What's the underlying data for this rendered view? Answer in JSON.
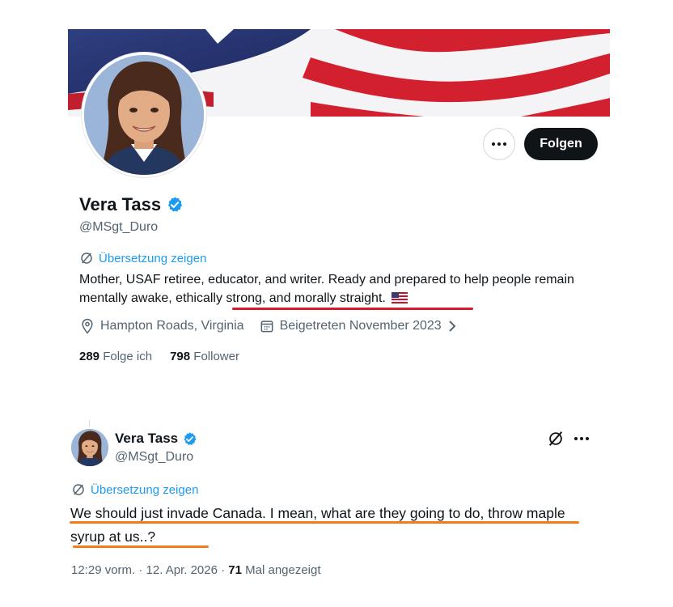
{
  "profile": {
    "name": "Vera Tass",
    "handle": "@MSgt_Duro",
    "translate_label": "Übersetzung zeigen",
    "bio_part1": "Mother, USAF retiree, educator, and writer.  Ready and prepared to help people remain mentally awake, ",
    "bio_part2": "ethically strong, and morally straight.",
    "location": "Hampton Roads, Virginia",
    "joined": "Beigetreten November 2023",
    "following_count": "289",
    "following_label": "Folge ich",
    "followers_count": "798",
    "followers_label": "Follower",
    "follow_button": "Folgen"
  },
  "tweet": {
    "name": "Vera Tass",
    "handle": "@MSgt_Duro",
    "translate_label": "Übersetzung zeigen",
    "text": "We should just invade Canada. I mean, what are they going to do, throw maple syrup at us..?",
    "time": "12:29 vorm. · 12. Apr. 2026 · ",
    "views_count": "71",
    "views_label": " Mal angezeigt"
  },
  "colors": {
    "accent": "#1d9bf0",
    "dark": "#0f1419",
    "muted": "#536471",
    "red_underline": "#d81b2b",
    "orange_underline": "#f07c1b"
  },
  "icons": [
    "verified-badge-icon",
    "translate-icon",
    "location-pin-icon",
    "calendar-icon",
    "chevron-right-icon",
    "more-dots-icon",
    "us-flag-emoji",
    "grok-icon"
  ]
}
